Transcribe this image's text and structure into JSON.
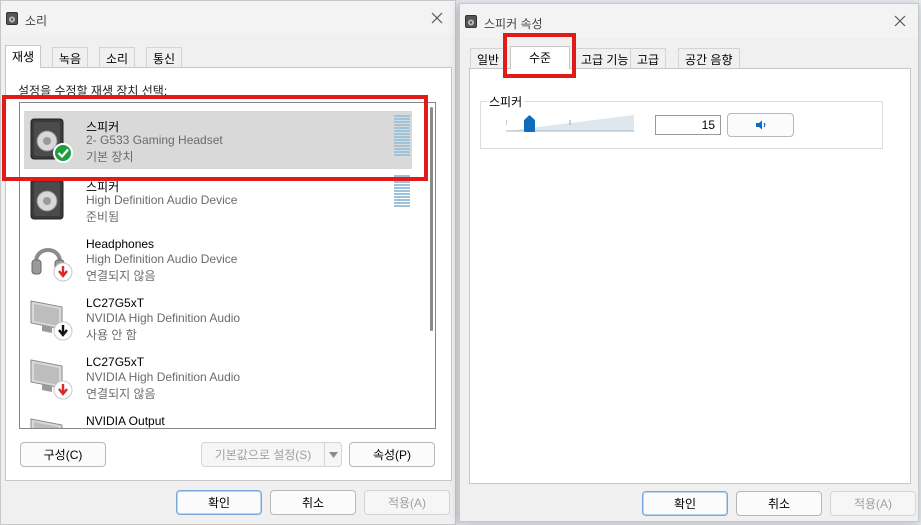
{
  "sound_window": {
    "title": "소리",
    "tabs": [
      {
        "label": "재생",
        "active": true
      },
      {
        "label": "녹음",
        "active": false
      },
      {
        "label": "소리",
        "active": false
      },
      {
        "label": "통신",
        "active": false
      }
    ],
    "instruction": "설정을 수정할 재생 장치 선택:",
    "devices": [
      {
        "name": "스피커",
        "description": "2- G533 Gaming Headset",
        "status": "기본 장치",
        "icon": "speaker-icon",
        "badge": "default-check-icon",
        "selected": true
      },
      {
        "name": "스피커",
        "description": "High Definition Audio Device",
        "status": "준비됨",
        "icon": "speaker-icon",
        "badge": "",
        "selected": false
      },
      {
        "name": "Headphones",
        "description": "High Definition Audio Device",
        "status": "연결되지 않음",
        "icon": "headphones-icon",
        "badge": "disconnected-arrow-icon",
        "selected": false
      },
      {
        "name": "LC27G5xT",
        "description": "NVIDIA High Definition Audio",
        "status": "사용 안 함",
        "icon": "monitor-icon",
        "badge": "disabled-arrow-icon",
        "selected": false
      },
      {
        "name": "LC27G5xT",
        "description": "NVIDIA High Definition Audio",
        "status": "연결되지 않음",
        "icon": "monitor-icon",
        "badge": "disconnected-arrow-icon",
        "selected": false
      },
      {
        "name": "NVIDIA Output",
        "description": "",
        "status": "",
        "icon": "monitor-icon",
        "badge": "",
        "selected": false
      }
    ],
    "configure_label": "구성(C)",
    "set_default_label": "기본값으로 설정(S)",
    "properties_label": "속성(P)",
    "ok_label": "확인",
    "cancel_label": "취소",
    "apply_label": "적용(A)"
  },
  "speaker_props": {
    "title": "스피커 속성",
    "tabs": [
      {
        "label": "일반",
        "active": false
      },
      {
        "label": "수준",
        "active": true
      },
      {
        "label": "고급 기능",
        "active": false
      },
      {
        "label": "고급",
        "active": false
      },
      {
        "label": "공간 음향",
        "active": false
      }
    ],
    "group_label": "스피커",
    "volume_value": "15",
    "volume_level": 0.15,
    "ok_label": "확인",
    "cancel_label": "취소",
    "apply_label": "적용(A)"
  },
  "colors": {
    "highlight": "#e21a1a",
    "selection": "#d9d9d9",
    "accent": "#0f6cbd",
    "check_badge": "#1e9e3e",
    "warning_badge": "#d62b2b"
  }
}
